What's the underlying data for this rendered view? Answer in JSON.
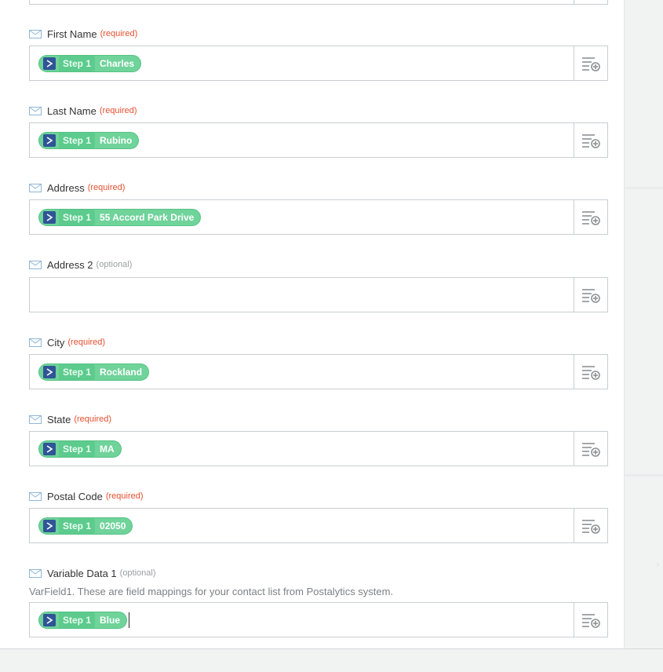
{
  "fields": [
    {
      "label": "First Name",
      "tag": "(required)",
      "tag_type": "req",
      "step": "Step 1",
      "value": "Charles"
    },
    {
      "label": "Last Name",
      "tag": "(required)",
      "tag_type": "req",
      "step": "Step 1",
      "value": "Rubino"
    },
    {
      "label": "Address",
      "tag": "(required)",
      "tag_type": "req",
      "step": "Step 1",
      "value": "55 Accord Park Drive"
    },
    {
      "label": "Address 2",
      "tag": "(optional)",
      "tag_type": "opt",
      "step": "",
      "value": ""
    },
    {
      "label": "City",
      "tag": "(required)",
      "tag_type": "req",
      "step": "Step 1",
      "value": "Rockland"
    },
    {
      "label": "State",
      "tag": "(required)",
      "tag_type": "req",
      "step": "Step 1",
      "value": "MA"
    },
    {
      "label": "Postal Code",
      "tag": "(required)",
      "tag_type": "req",
      "step": "Step 1",
      "value": "02050"
    },
    {
      "label": "Variable Data 1",
      "tag": "(optional)",
      "tag_type": "opt",
      "step": "Step 1",
      "value": "Blue",
      "help": "VarField1. These are field mappings for your contact list from Postalytics system."
    }
  ],
  "icons": {
    "label_icon": "envelope-icon",
    "insert_button_icon": "insert-field-icon",
    "app_icon": "app-arrow-icon"
  },
  "colors": {
    "pill": "#6fd39a",
    "required": "#e5502f",
    "optional": "#9a9ea1",
    "app_icon": "#2f5597"
  }
}
